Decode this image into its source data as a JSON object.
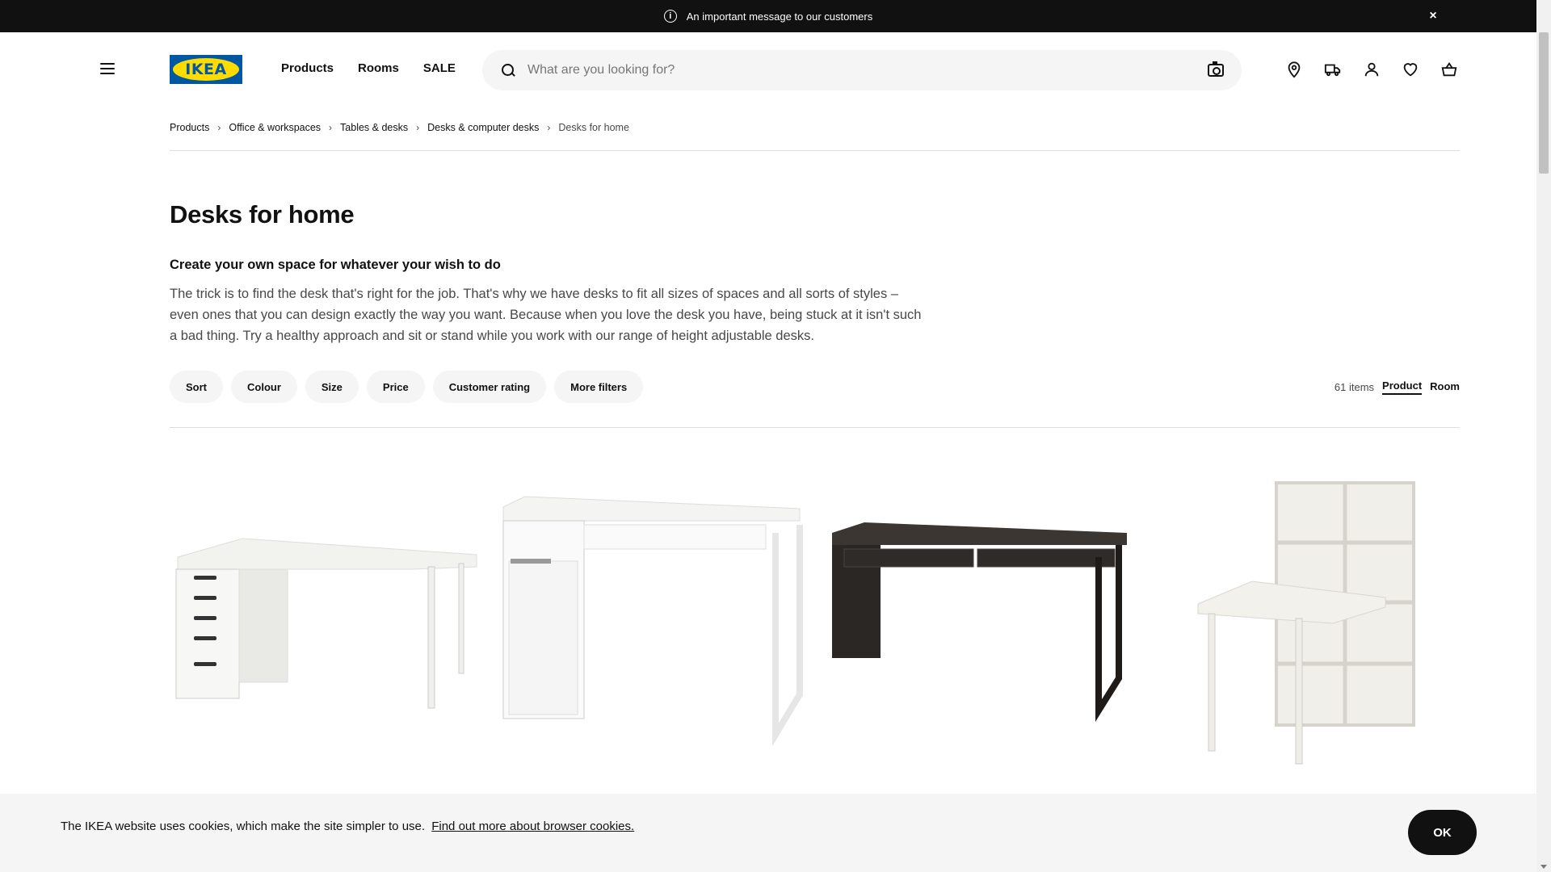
{
  "announcement": {
    "text": "An important message to our customers",
    "close": "×"
  },
  "header": {
    "logo": "IKEA",
    "nav": [
      "Products",
      "Rooms",
      "SALE"
    ],
    "search_placeholder": "What are you looking for?",
    "icons": [
      "location-icon",
      "delivery-truck-icon",
      "user-icon",
      "heart-icon",
      "cart-icon"
    ]
  },
  "breadcrumb": [
    "Products",
    "Office & workspaces",
    "Tables & desks",
    "Desks & computer desks",
    "Desks for home"
  ],
  "page": {
    "title": "Desks for home",
    "intro_heading": "Create your own space for whatever your wish to do",
    "intro_text": "The trick is to find the desk that's right for the job. That's why we have desks to fit all sizes of spaces and all sorts of styles – even ones that you can design exactly the way you want. Because when you love the desk you have, being stuck at it isn't such a bad thing. Try a healthy approach and sit or stand while you work with our range of height adjustable desks."
  },
  "filters": [
    "Sort",
    "Colour",
    "Size",
    "Price",
    "Customer rating",
    "More filters"
  ],
  "view": {
    "count": "61 items",
    "options": [
      "Product",
      "Room"
    ],
    "active": "Product"
  },
  "cookie": {
    "text": "The IKEA website uses cookies, which make the site simpler to use.",
    "link": "Find out more about browser cookies.",
    "ok": "OK"
  },
  "colors": {
    "brand_blue": "#0058a3",
    "brand_yellow": "#ffdb00",
    "dark": "#111111"
  }
}
